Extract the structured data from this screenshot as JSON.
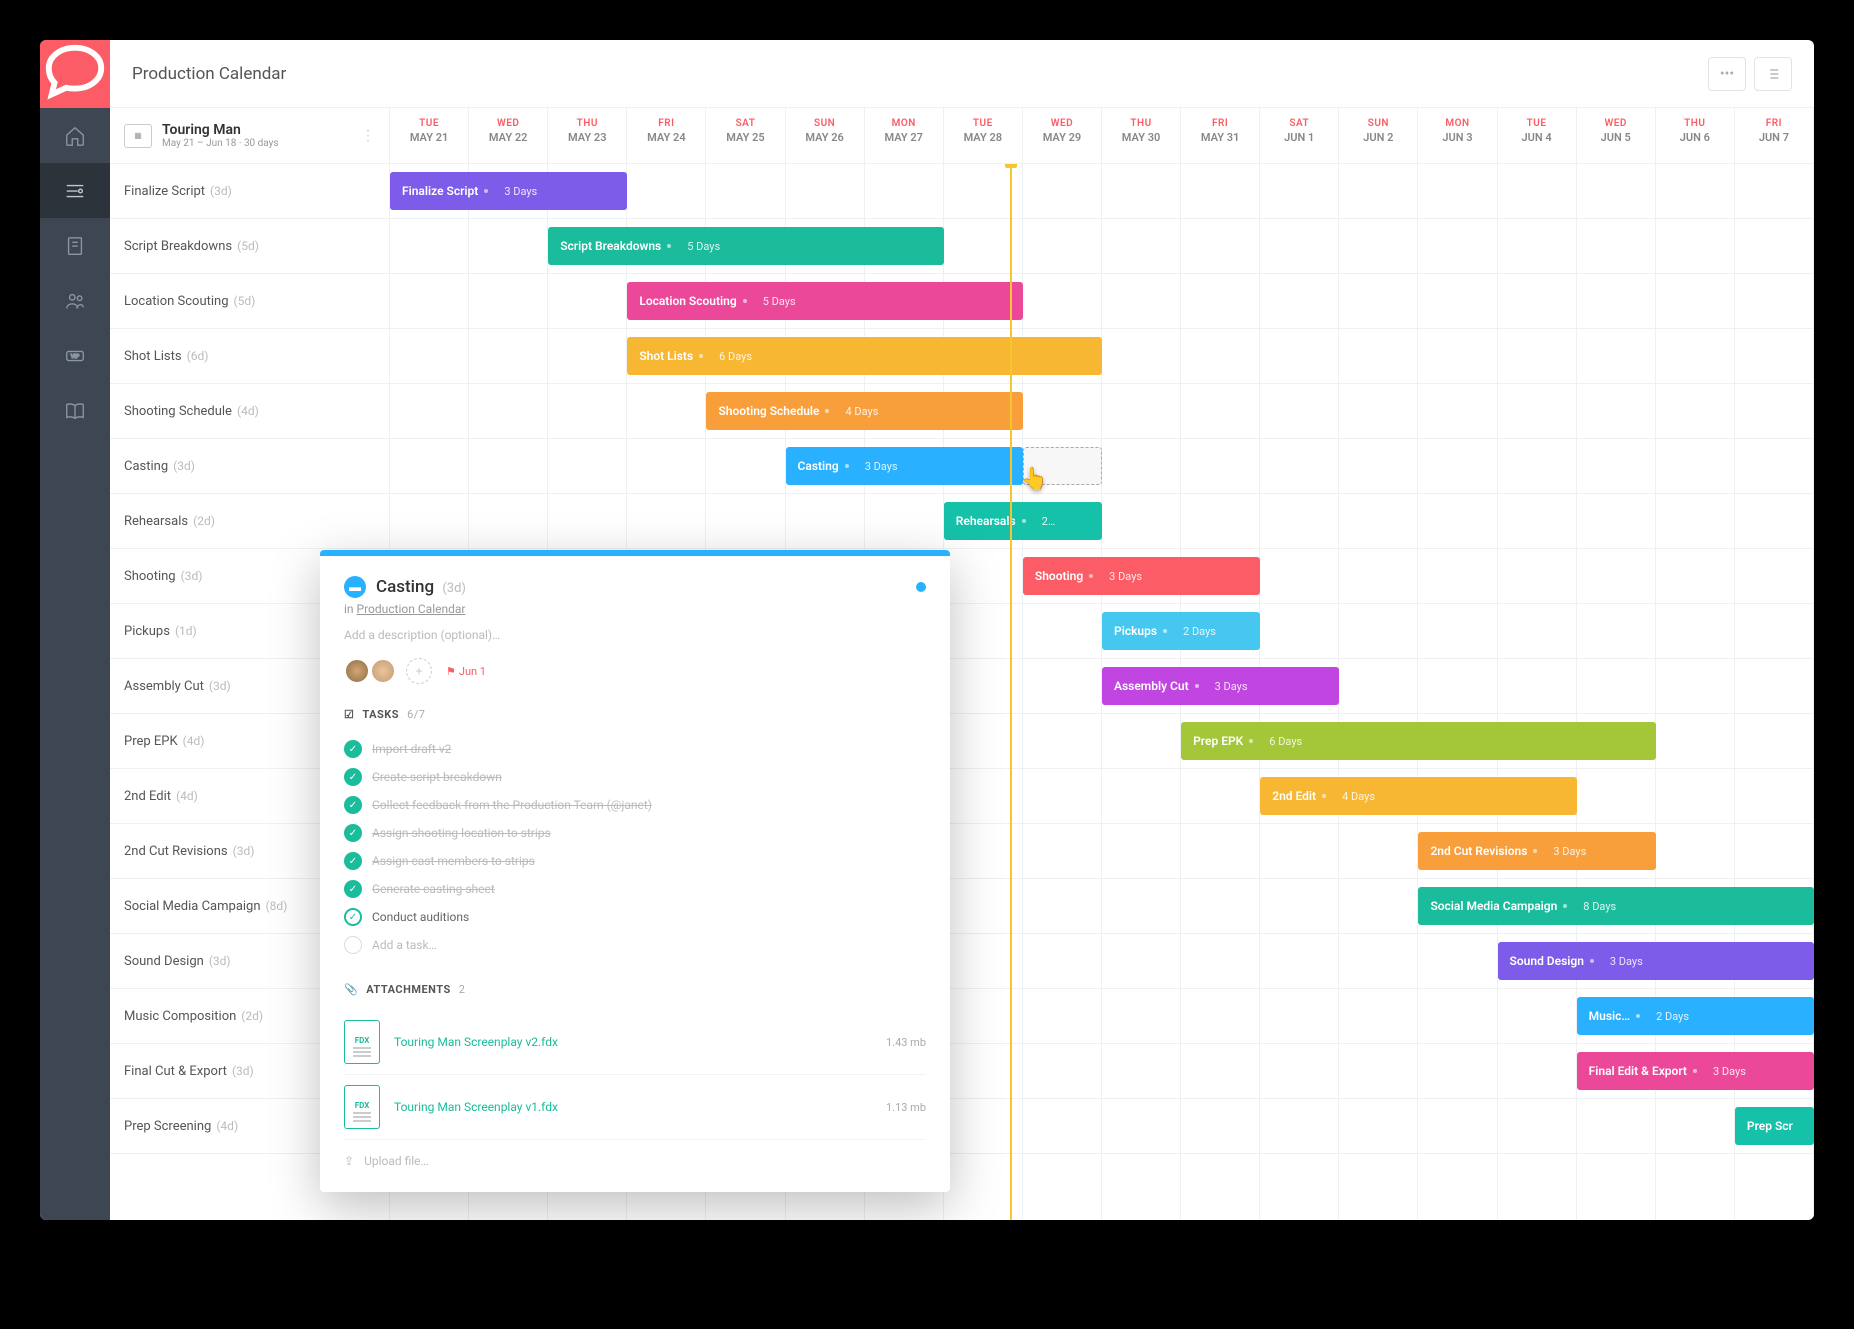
{
  "header": {
    "title": "Production Calendar"
  },
  "project": {
    "name": "Touring Man",
    "range": "May 21 – Jun 18",
    "duration": "30 days"
  },
  "dates": [
    {
      "dow": "TUE",
      "label": "MAY 21"
    },
    {
      "dow": "WED",
      "label": "MAY 22"
    },
    {
      "dow": "THU",
      "label": "MAY 23"
    },
    {
      "dow": "FRI",
      "label": "MAY 24"
    },
    {
      "dow": "SAT",
      "label": "MAY 25"
    },
    {
      "dow": "SUN",
      "label": "MAY 26"
    },
    {
      "dow": "MON",
      "label": "MAY 27"
    },
    {
      "dow": "TUE",
      "label": "MAY 28"
    },
    {
      "dow": "WED",
      "label": "MAY 29"
    },
    {
      "dow": "THU",
      "label": "MAY 30"
    },
    {
      "dow": "FRI",
      "label": "MAY 31"
    },
    {
      "dow": "SAT",
      "label": "JUN 1"
    },
    {
      "dow": "SUN",
      "label": "JUN 2"
    },
    {
      "dow": "MON",
      "label": "JUN 3"
    },
    {
      "dow": "TUE",
      "label": "JUN 4"
    },
    {
      "dow": "WED",
      "label": "JUN 5"
    },
    {
      "dow": "THU",
      "label": "JUN 6"
    },
    {
      "dow": "FRI",
      "label": "JUN 7"
    }
  ],
  "today_index": 8,
  "tasks": [
    {
      "name": "Finalize Script",
      "dur": "3d",
      "bar_label": "Finalize Script",
      "bar_dur": "3 Days",
      "start": 0,
      "span": 3,
      "color": "#7c5ce8"
    },
    {
      "name": "Script Breakdowns",
      "dur": "5d",
      "bar_label": "Script Breakdowns",
      "bar_dur": "5 Days",
      "start": 2,
      "span": 5,
      "color": "#1abc9c"
    },
    {
      "name": "Location Scouting",
      "dur": "5d",
      "bar_label": "Location Scouting",
      "bar_dur": "5 Days",
      "start": 3,
      "span": 5,
      "color": "#ec4899"
    },
    {
      "name": "Shot Lists",
      "dur": "6d",
      "bar_label": "Shot Lists",
      "bar_dur": "6 Days",
      "start": 3,
      "span": 6,
      "color": "#f7b733"
    },
    {
      "name": "Shooting Schedule",
      "dur": "4d",
      "bar_label": "Shooting Schedule",
      "bar_dur": "4 Days",
      "start": 4,
      "span": 4,
      "color": "#f89f3c"
    },
    {
      "name": "Casting",
      "dur": "3d",
      "bar_label": "Casting",
      "bar_dur": "3 Days",
      "start": 5,
      "span": 3,
      "color": "#29b0ff",
      "ghost_span": 1
    },
    {
      "name": "Rehearsals",
      "dur": "2d",
      "bar_label": "Rehearsals",
      "bar_dur": "2…",
      "start": 7,
      "span": 2,
      "color": "#16c1a9"
    },
    {
      "name": "Shooting",
      "dur": "3d",
      "bar_label": "Shooting",
      "bar_dur": "3 Days",
      "start": 8,
      "span": 3,
      "color": "#fc5c65"
    },
    {
      "name": "Pickups",
      "dur": "1d",
      "bar_label": "Pickups",
      "bar_dur": "2 Days",
      "start": 9,
      "span": 2,
      "color": "#45c7f0"
    },
    {
      "name": "Assembly Cut",
      "dur": "3d",
      "bar_label": "Assembly Cut",
      "bar_dur": "3 Days",
      "start": 9,
      "span": 3,
      "color": "#c145e0"
    },
    {
      "name": "Prep EPK",
      "dur": "4d",
      "bar_label": "Prep EPK",
      "bar_dur": "6 Days",
      "start": 10,
      "span": 6,
      "color": "#a4c639"
    },
    {
      "name": "2nd Edit",
      "dur": "4d",
      "bar_label": "2nd Edit",
      "bar_dur": "4 Days",
      "start": 11,
      "span": 4,
      "color": "#f7b733"
    },
    {
      "name": "2nd Cut Revisions",
      "dur": "3d",
      "bar_label": "2nd Cut Revisions",
      "bar_dur": "3 Days",
      "start": 13,
      "span": 3,
      "color": "#f89f3c"
    },
    {
      "name": "Social Media Campaign",
      "dur": "8d",
      "bar_label": "Social Media Campaign",
      "bar_dur": "8 Days",
      "start": 13,
      "span": 5,
      "color": "#1abc9c"
    },
    {
      "name": "Sound Design",
      "dur": "3d",
      "bar_label": "Sound Design",
      "bar_dur": "3 Days",
      "start": 14,
      "span": 4,
      "color": "#7c5ce8"
    },
    {
      "name": "Music Composition",
      "dur": "2d",
      "bar_label": "Music…",
      "bar_dur": "2 Days",
      "start": 15,
      "span": 3,
      "color": "#29b0ff"
    },
    {
      "name": "Final Cut & Export",
      "dur": "3d",
      "bar_label": "Final Edit & Export",
      "bar_dur": "3 Days",
      "start": 15,
      "span": 3,
      "color": "#ec4899"
    },
    {
      "name": "Prep Screening",
      "dur": "4d",
      "bar_label": "Prep Scr",
      "bar_dur": "",
      "start": 17,
      "span": 1,
      "color": "#16c1a9"
    }
  ],
  "detail": {
    "title": "Casting",
    "dur": "(3d)",
    "in_prefix": "in ",
    "calendar_link": "Production Calendar",
    "desc_placeholder": "Add a description (optional)…",
    "flag_date": "Jun 1",
    "tasks_label": "TASKS",
    "tasks_count": "6/7",
    "checks": [
      {
        "done": true,
        "text": "Import draft v2"
      },
      {
        "done": true,
        "text": "Create script breakdown"
      },
      {
        "done": true,
        "text": "Collect feedback from the Production Team (@janet)"
      },
      {
        "done": true,
        "text": "Assign shooting location to strips"
      },
      {
        "done": true,
        "text": "Assign cast members to strips"
      },
      {
        "done": true,
        "text": "Generate casting sheet"
      },
      {
        "done": false,
        "text": "Conduct auditions"
      }
    ],
    "add_task": "Add a task…",
    "attach_label": "ATTACHMENTS",
    "attach_count": "2",
    "attachments": [
      {
        "ext": "FDX",
        "name": "Touring Man Screenplay v2.fdx",
        "size": "1.43 mb"
      },
      {
        "ext": "FDX",
        "name": "Touring Man Screenplay v1.fdx",
        "size": "1.13 mb"
      }
    ],
    "upload": "Upload file…"
  }
}
